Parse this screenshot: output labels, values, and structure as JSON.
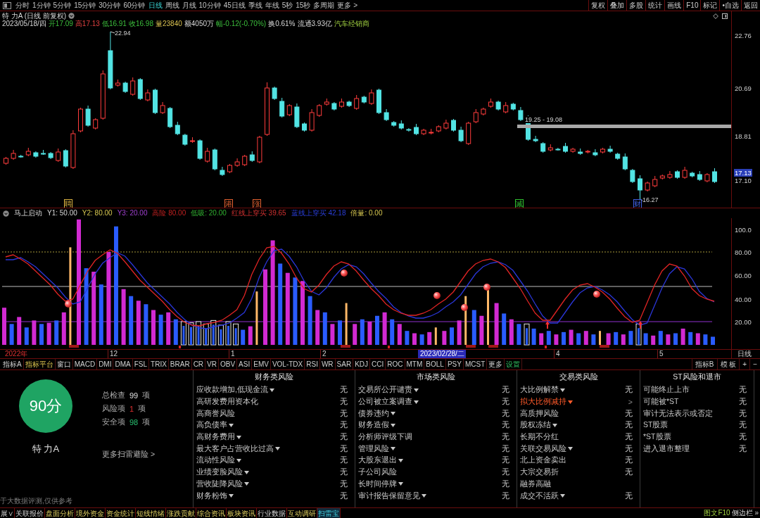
{
  "toolbar": {
    "periods": [
      {
        "label": "分时",
        "selected": false
      },
      {
        "label": "1分钟",
        "selected": false
      },
      {
        "label": "5分钟",
        "selected": false
      },
      {
        "label": "15分钟",
        "selected": false
      },
      {
        "label": "30分钟",
        "selected": false
      },
      {
        "label": "60分钟",
        "selected": false
      },
      {
        "label": "日线",
        "selected": true
      },
      {
        "label": "周线",
        "selected": false
      },
      {
        "label": "月线",
        "selected": false
      },
      {
        "label": "10分钟",
        "selected": false
      },
      {
        "label": "45日线",
        "selected": false
      },
      {
        "label": "季线",
        "selected": false
      },
      {
        "label": "年线",
        "selected": false
      },
      {
        "label": "5秒",
        "selected": false
      },
      {
        "label": "15秒",
        "selected": false
      },
      {
        "label": "多周期",
        "selected": false
      },
      {
        "label": "更多 >",
        "selected": false
      }
    ],
    "actions": [
      "复权",
      "叠加",
      "多股",
      "统计",
      "画线",
      "F10",
      "标记",
      "•自选",
      "返回"
    ]
  },
  "quote": {
    "title": "特 力A (日线 前复权)",
    "fields": [
      {
        "text": "2023/05/18/四",
        "kind": "plain"
      },
      {
        "text": "开17.09",
        "kind": "down"
      },
      {
        "text": "高17.13",
        "kind": "up"
      },
      {
        "text": "低16.91",
        "kind": "down"
      },
      {
        "text": "收16.98",
        "kind": "down"
      },
      {
        "text": "量23840",
        "kind": "volume"
      },
      {
        "text": "额4050万",
        "kind": "plain"
      },
      {
        "text": "幅-0.12(-0.70%)",
        "kind": "down"
      },
      {
        "text": "换0.61%",
        "kind": "plain"
      },
      {
        "text": "流通3.93亿",
        "kind": "plain"
      },
      {
        "text": "汽车经销商",
        "kind": "industry"
      }
    ]
  },
  "price_chart": {
    "axis_labels": [
      {
        "text": "22.76",
        "kind": "tick"
      },
      {
        "text": "20.69",
        "kind": "tick"
      },
      {
        "text": "18.81",
        "kind": "tick"
      },
      {
        "text": "17.13",
        "kind": "current"
      },
      {
        "text": "17.10",
        "kind": "tick"
      }
    ],
    "high_label": "22.94",
    "low_label": "16.27",
    "zone_label": "19.25 - 19.08",
    "events": [
      {
        "text": "聘",
        "color": "#d8b040"
      },
      {
        "text": "港",
        "color": "#e06030"
      },
      {
        "text": "涨",
        "color": "#e06030"
      },
      {
        "text": "减",
        "color": "#30c030"
      },
      {
        "text": "财",
        "color": "#4060e0"
      }
    ]
  },
  "indicator": {
    "name": "马上启动",
    "params": [
      {
        "text": "Y1: 50.00",
        "kind": "y1"
      },
      {
        "text": "Y2: 80.00",
        "kind": "y2"
      },
      {
        "text": "Y3: 20.00",
        "kind": "y3"
      },
      {
        "text": "高险 80.00",
        "kind": "high"
      },
      {
        "text": "低吸: 20.00",
        "kind": "low"
      },
      {
        "text": "红线上穿买 39.65",
        "kind": "red_cross"
      },
      {
        "text": "蓝线上穿买 42.18",
        "kind": "blue_cross"
      },
      {
        "text": "倍量: 0.00",
        "kind": "volume_ratio"
      }
    ],
    "axis_labels": [
      "100.0",
      "80.00",
      "60.00",
      "40.00",
      "20.00"
    ]
  },
  "time_axis": {
    "labels": [
      {
        "text": "2022年",
        "kind": "year"
      },
      {
        "text": "12",
        "kind": "month"
      },
      {
        "text": "1",
        "kind": "month"
      },
      {
        "text": "2",
        "kind": "month"
      },
      {
        "text": "2023/02/28/二",
        "kind": "cursor"
      },
      {
        "text": "4",
        "kind": "month"
      },
      {
        "text": "5",
        "kind": "month"
      }
    ],
    "period": "日线"
  },
  "indicator_tabs": {
    "left": [
      {
        "label": "指标A",
        "selected": false,
        "kind": "normal"
      },
      {
        "label": "指标平台",
        "selected": false,
        "kind": "platform"
      },
      {
        "label": "窗口",
        "selected": false,
        "kind": "normal"
      },
      {
        "label": "MACD",
        "selected": false,
        "kind": "normal"
      },
      {
        "label": "DMI",
        "selected": false,
        "kind": "normal"
      },
      {
        "label": "DMA",
        "selected": false,
        "kind": "normal"
      },
      {
        "label": "FSL",
        "selected": false,
        "kind": "normal"
      },
      {
        "label": "TRIX",
        "selected": false,
        "kind": "normal"
      },
      {
        "label": "BRAR",
        "selected": false,
        "kind": "normal"
      },
      {
        "label": "CR",
        "selected": false,
        "kind": "normal"
      },
      {
        "label": "VR",
        "selected": false,
        "kind": "normal"
      },
      {
        "label": "OBV",
        "selected": false,
        "kind": "normal"
      },
      {
        "label": "ASI",
        "selected": false,
        "kind": "normal"
      },
      {
        "label": "EMV",
        "selected": false,
        "kind": "normal"
      },
      {
        "label": "VOL-TDX",
        "selected": false,
        "kind": "normal"
      },
      {
        "label": "RSI",
        "selected": false,
        "kind": "normal"
      },
      {
        "label": "WR",
        "selected": false,
        "kind": "normal"
      },
      {
        "label": "SAR",
        "selected": false,
        "kind": "normal"
      },
      {
        "label": "KDJ",
        "selected": false,
        "kind": "normal"
      },
      {
        "label": "CCI",
        "selected": false,
        "kind": "normal"
      },
      {
        "label": "ROC",
        "selected": false,
        "kind": "normal"
      },
      {
        "label": "MTM",
        "selected": false,
        "kind": "normal"
      },
      {
        "label": "BOLL",
        "selected": false,
        "kind": "normal"
      },
      {
        "label": "PSY",
        "selected": false,
        "kind": "normal"
      },
      {
        "label": "MCST",
        "selected": false,
        "kind": "normal"
      },
      {
        "label": "更多",
        "selected": false,
        "kind": "normal"
      },
      {
        "label": "设置",
        "selected": false,
        "kind": "settings"
      }
    ],
    "right": [
      "指标B",
      "模 板",
      "+",
      "−"
    ]
  },
  "scan": {
    "score": "90分",
    "stock": "特 力A",
    "stats": [
      {
        "label": "总检查",
        "value": "99",
        "unit": "项",
        "kind": "total"
      },
      {
        "label": "风险项",
        "value": "1",
        "unit": "项",
        "kind": "risk"
      },
      {
        "label": "安全项",
        "value": "98",
        "unit": "项",
        "kind": "safe"
      }
    ],
    "more_link": "更多扫雷避险 >",
    "disclaimer": "于大数据评测,仅供参考",
    "groups": [
      {
        "title": "财务类风险",
        "items": [
          {
            "label": "应收款增加,低现金流",
            "dropdown": true,
            "flagged": false,
            "value": "无"
          },
          {
            "label": "高研发费用资本化",
            "dropdown": false,
            "flagged": false,
            "value": "无"
          },
          {
            "label": "高商誉风险",
            "dropdown": false,
            "flagged": false,
            "value": "无"
          },
          {
            "label": "高负债率",
            "dropdown": true,
            "flagged": false,
            "value": "无"
          },
          {
            "label": "高财务费用",
            "dropdown": true,
            "flagged": false,
            "value": "无"
          },
          {
            "label": "最大客户占营收比过高",
            "dropdown": true,
            "flagged": false,
            "value": "无"
          },
          {
            "label": "流动性风险",
            "dropdown": true,
            "flagged": false,
            "value": "无"
          },
          {
            "label": "业绩变脸风险",
            "dropdown": true,
            "flagged": false,
            "value": "无"
          },
          {
            "label": "营收陡降风险",
            "dropdown": true,
            "flagged": false,
            "value": "无"
          },
          {
            "label": "财务粉饰",
            "dropdown": true,
            "flagged": false,
            "value": "无"
          }
        ]
      },
      {
        "title": "市场类风险",
        "items": [
          {
            "label": "交易所公开谴责",
            "dropdown": true,
            "flagged": false,
            "value": "无"
          },
          {
            "label": "公司被立案调查",
            "dropdown": true,
            "flagged": false,
            "value": "无"
          },
          {
            "label": "债券违约",
            "dropdown": true,
            "flagged": false,
            "value": "无"
          },
          {
            "label": "财务造假",
            "dropdown": true,
            "flagged": false,
            "value": "无"
          },
          {
            "label": "分析师评级下调",
            "dropdown": false,
            "flagged": false,
            "value": "无"
          },
          {
            "label": "管理风险",
            "dropdown": true,
            "flagged": false,
            "value": "无"
          },
          {
            "label": "大股东退出",
            "dropdown": true,
            "flagged": false,
            "value": "无"
          },
          {
            "label": "子公司风险",
            "dropdown": false,
            "flagged": false,
            "value": "无"
          },
          {
            "label": "长时间停牌",
            "dropdown": true,
            "flagged": false,
            "value": "无"
          },
          {
            "label": "审计报告保留意见",
            "dropdown": true,
            "flagged": false,
            "value": "无"
          }
        ]
      },
      {
        "title": "交易类风险",
        "items": [
          {
            "label": "大比例解禁",
            "dropdown": true,
            "flagged": false,
            "value": "无"
          },
          {
            "label": "拟大比例减持",
            "dropdown": true,
            "flagged": true,
            "value": ">"
          },
          {
            "label": "高质押风险",
            "dropdown": false,
            "flagged": false,
            "value": "无"
          },
          {
            "label": "股权冻结",
            "dropdown": true,
            "flagged": false,
            "value": "无"
          },
          {
            "label": "长期不分红",
            "dropdown": false,
            "flagged": false,
            "value": "无"
          },
          {
            "label": "关联交易风险",
            "dropdown": true,
            "flagged": false,
            "value": "无"
          },
          {
            "label": "北上资金卖出",
            "dropdown": false,
            "flagged": false,
            "value": "无"
          },
          {
            "label": "大宗交易折",
            "dropdown": false,
            "flagged": false,
            "value": "无"
          },
          {
            "label": "融券高融",
            "dropdown": false,
            "flagged": false
          },
          {
            "label": "成交不活跃",
            "dropdown": true,
            "flagged": false,
            "value": "无"
          }
        ]
      },
      {
        "title": "ST风险和退市",
        "items": [
          {
            "label": "可能终止上市",
            "dropdown": false,
            "flagged": false,
            "value": "无"
          },
          {
            "label": "可能被*ST",
            "dropdown": false,
            "flagged": false,
            "value": "无"
          },
          {
            "label": "审计无法表示或否定",
            "dropdown": false,
            "flagged": false,
            "value": "无"
          },
          {
            "label": "ST股票",
            "dropdown": false,
            "flagged": false,
            "value": "无"
          },
          {
            "label": "*ST股票",
            "dropdown": false,
            "flagged": false,
            "value": "无"
          },
          {
            "label": "进入退市整理",
            "dropdown": false,
            "flagged": false,
            "value": "无"
          }
        ]
      }
    ]
  },
  "bottom_tabs": {
    "items": [
      {
        "label": "展∨",
        "selected": false,
        "kind": "normal"
      },
      {
        "label": "关联报价",
        "selected": false,
        "kind": "normal"
      },
      {
        "label": "盘面分析",
        "selected": false,
        "kind": "feature"
      },
      {
        "label": "境外资金",
        "selected": false,
        "kind": "feature"
      },
      {
        "label": "资金统计",
        "selected": false,
        "kind": "feature"
      },
      {
        "label": "短线情绪",
        "selected": false,
        "kind": "feature"
      },
      {
        "label": "涨跌贡献",
        "selected": false,
        "kind": "feature"
      },
      {
        "label": "综合资讯",
        "selected": false,
        "kind": "feature"
      },
      {
        "label": "板块资讯",
        "selected": false,
        "kind": "feature"
      },
      {
        "label": "行业数据",
        "selected": false,
        "kind": "normal"
      },
      {
        "label": "互动调研",
        "selected": false,
        "kind": "feature"
      },
      {
        "label": "扫雷宝",
        "selected": true,
        "kind": "normal"
      }
    ],
    "f10": "图文F10",
    "sidebar": "侧边栏 »"
  }
}
